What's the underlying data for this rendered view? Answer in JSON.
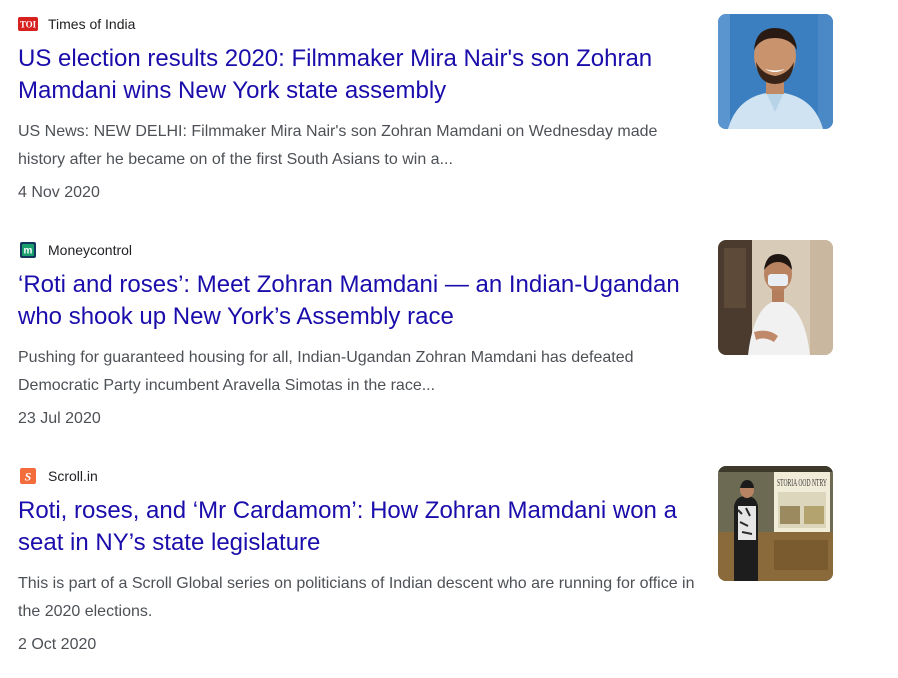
{
  "results": [
    {
      "source": "Times of India",
      "favicon_icon": "toi-icon",
      "favicon_text": "TOI",
      "title": "US election results 2020: Filmmaker Mira Nair's son Zohran Mamdani wins New York state assembly",
      "snippet": "US News: NEW DELHI: Filmmaker Mira Nair's son Zohran Mamdani on Wednesday made history after he became on of the first South Asians to win a...",
      "date": "4 Nov 2020"
    },
    {
      "source": "Moneycontrol",
      "favicon_icon": "moneycontrol-icon",
      "favicon_text": "m",
      "title": "‘Roti and roses’: Meet Zohran Mamdani — an Indian-Ugandan who shook up New York’s Assembly race",
      "snippet": "Pushing for guaranteed housing for all, Indian-Ugandan Zohran Mamdani has defeated Democratic Party incumbent Aravella Simotas in the race...",
      "date": "23 Jul 2020"
    },
    {
      "source": "Scroll.in",
      "favicon_icon": "scroll-icon",
      "favicon_text": "S",
      "title": "Roti, roses, and ‘Mr Cardamom’: How Zohran Mamdani won a seat in NY’s state legislature",
      "snippet": "This is part of a Scroll Global series on politicians of Indian descent who are running for office in the 2020 elections.",
      "date": "2 Oct 2020",
      "thumb_sign": "STORIA OOD NTRY"
    }
  ],
  "colors": {
    "title_link": "#1a0dab",
    "snippet_text": "#4d5156",
    "source_text": "#202124",
    "toi_red": "#d6211f",
    "moneycontrol_green": "#1aa06d",
    "scroll_orange": "#f26c3c"
  }
}
